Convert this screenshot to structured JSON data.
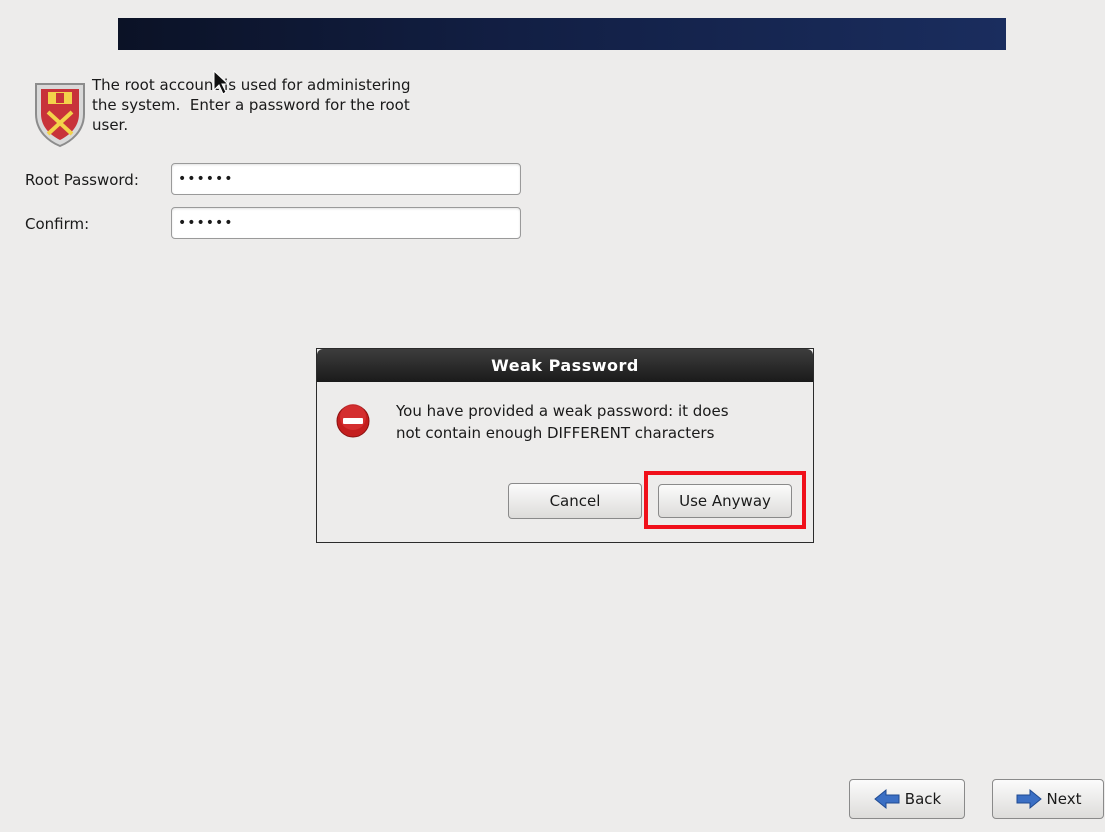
{
  "intro": {
    "line1": "The root account is used for administering",
    "line2": "the system.  Enter a password for the root",
    "line3": "user."
  },
  "form": {
    "root_password_label": "Root Password:",
    "root_password_value": "••••••",
    "confirm_label": "Confirm:",
    "confirm_value": "••••••"
  },
  "dialog": {
    "title": "Weak Password",
    "message_line1": "You have provided a weak password: it does",
    "message_line2": "not contain enough DIFFERENT characters",
    "cancel_label": "Cancel",
    "use_anyway_label": "Use Anyway",
    "icon": "error-icon"
  },
  "nav": {
    "back_label": "Back",
    "next_label": "Next",
    "back_icon": "arrow-left-icon",
    "next_icon": "arrow-right-icon"
  },
  "colors": {
    "highlight": "#f0101a",
    "banner": "#0b1226",
    "arrow": "#3b6fc4"
  }
}
